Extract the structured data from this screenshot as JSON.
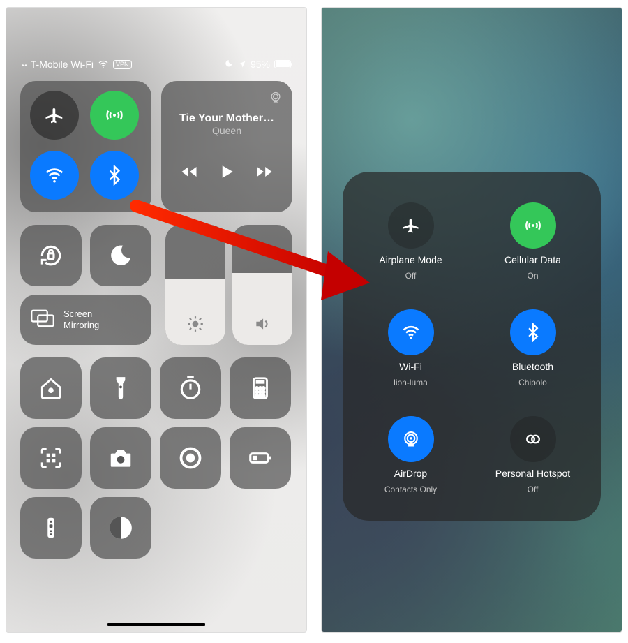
{
  "status": {
    "carrier": "T-Mobile Wi-Fi",
    "vpn": "VPN",
    "battery_pct": "95%"
  },
  "media": {
    "title": "Tie Your Mother…",
    "artist": "Queen"
  },
  "mirror_label": "Screen\nMirroring",
  "expanded": {
    "airplane": {
      "label": "Airplane Mode",
      "sub": "Off"
    },
    "cellular": {
      "label": "Cellular Data",
      "sub": "On"
    },
    "wifi": {
      "label": "Wi-Fi",
      "sub": "lion-luma"
    },
    "bluetooth": {
      "label": "Bluetooth",
      "sub": "Chipolo"
    },
    "airdrop": {
      "label": "AirDrop",
      "sub": "Contacts Only"
    },
    "hotspot": {
      "label": "Personal Hotspot",
      "sub": "Off"
    }
  }
}
